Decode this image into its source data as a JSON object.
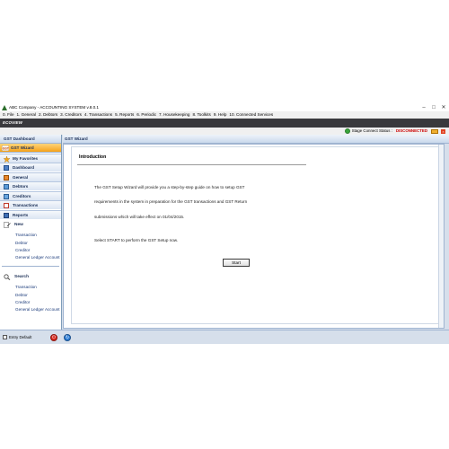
{
  "window": {
    "title": "ABC Company - ACCOUNTING SYSTEM v.8.0.1",
    "buttons": [
      "–",
      "□",
      "✕"
    ]
  },
  "menubar": [
    "0. File",
    "1. General",
    "2. Debtors",
    "3. Creditors",
    "4. Transactions",
    "5. Reports",
    "6. Periodic",
    "7. Housekeeping",
    "8. Toolkits",
    "9. Help",
    "10. Connected Services"
  ],
  "toolbar": {
    "brand": "ECOVIEW"
  },
  "status": {
    "label": "Stage Connect Status :",
    "value": "DISCONNECTED",
    "value_color": "#cc0000"
  },
  "sidebar": {
    "dashboard_header": "GST Dashboard",
    "wizard_header": "GST Wizard",
    "nav_items": [
      "My Favorites",
      "Dashboard",
      "General",
      "Debtors",
      "Creditors",
      "Transactions",
      "Reports"
    ],
    "new_section": {
      "title": "New",
      "links": [
        "Transaction",
        "Debtor",
        "Creditor",
        "General Ledger Account"
      ]
    },
    "search_section": {
      "title": "Search",
      "links": [
        "Transaction",
        "Debtor",
        "Creditor",
        "General Ledger Account"
      ]
    }
  },
  "panel": {
    "title": "GST Wizard"
  },
  "wizard": {
    "heading": "Introduction",
    "line1": "The GST Setup Wizard will provide you a step-by-step guide on how to setup GST",
    "line2": "requirements in the system in preparation for the GST transactions and GST Return",
    "line3": "submissions which will take effect on 01/04/2015.",
    "line4": "Select START to perform the GST Setup now.",
    "start_label": "Start"
  },
  "bottom": {
    "entry_default_label": "Entry Default"
  },
  "colors": {
    "accent_orange": "#f6a219",
    "header_blue": "#c9d8ec",
    "toolbar_dark": "#39393d"
  }
}
